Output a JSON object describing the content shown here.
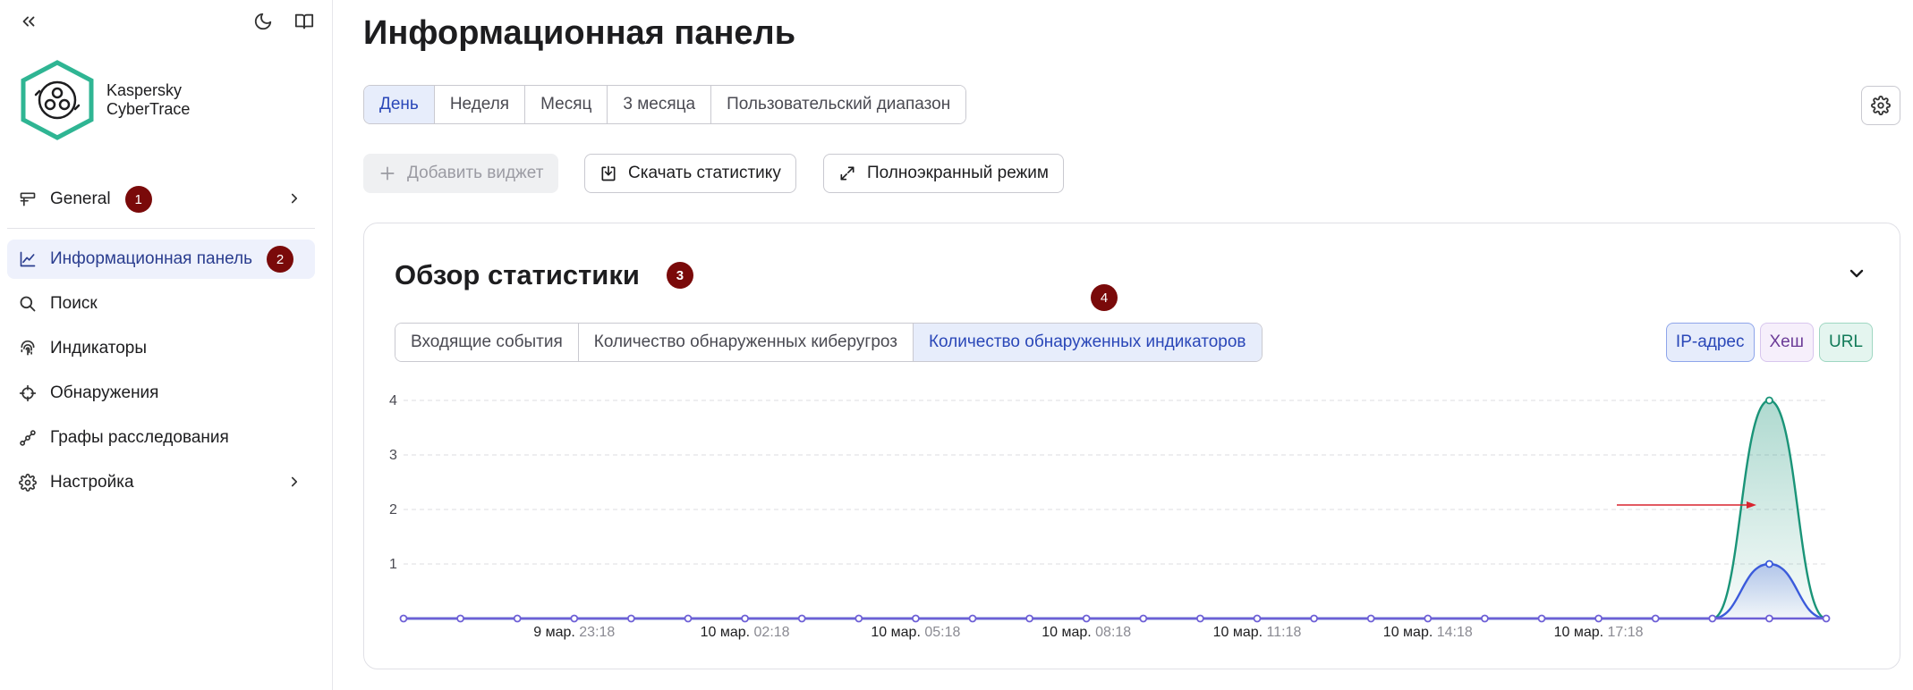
{
  "sidebar": {
    "brand_line1": "Kaspersky",
    "brand_line2": "CyberTrace",
    "icons": {
      "collapse": "double-chevron-left-icon",
      "theme": "moon-icon",
      "docs": "book-icon"
    },
    "items": [
      {
        "label": "General",
        "icon": "layout-icon",
        "badge": "1",
        "has_submenu": true
      },
      {
        "label": "Информационная панель",
        "icon": "chart-line-icon",
        "badge": "2",
        "active": true
      },
      {
        "label": "Поиск",
        "icon": "search-icon"
      },
      {
        "label": "Индикаторы",
        "icon": "fingerprint-icon"
      },
      {
        "label": "Обнаружения",
        "icon": "crosshair-icon"
      },
      {
        "label": "Графы расследования",
        "icon": "graph-icon"
      },
      {
        "label": "Настройка",
        "icon": "gear-icon",
        "has_submenu": true
      }
    ]
  },
  "main": {
    "title": "Информационная панель",
    "periods": [
      "День",
      "Неделя",
      "Месяц",
      "3 месяца",
      "Пользовательский диапазон"
    ],
    "active_period": "День",
    "toolbar": {
      "add_widget": "Добавить виджет",
      "download_stats": "Скачать статистику",
      "fullscreen": "Полноэкранный режим"
    }
  },
  "card": {
    "title": "Обзор статистики",
    "title_badge": "3",
    "float_badge": "4",
    "metrics": [
      "Входящие события",
      "Количество обнаруженных киберугроз",
      "Количество обнаруженных индикаторов"
    ],
    "active_metric": "Количество обнаруженных индикаторов",
    "legend": [
      "IP-адрес",
      "Хеш",
      "URL"
    ]
  },
  "colors": {
    "accent": "#2a47b8",
    "badge": "#7a0a0a",
    "series_ip": "#3b5bdb",
    "series_hash": "#8e5cc8",
    "series_url": "#1a9478",
    "arrow": "#d9232e"
  },
  "chart_data": {
    "type": "area",
    "y_ticks": [
      "1",
      "2",
      "3",
      "4"
    ],
    "ylim": [
      0,
      4
    ],
    "x_labels": [
      {
        "date": "9 мар.",
        "time": "23:18"
      },
      {
        "date": "10 мар.",
        "time": "02:18"
      },
      {
        "date": "10 мар.",
        "time": "05:18"
      },
      {
        "date": "10 мар.",
        "time": "08:18"
      },
      {
        "date": "10 мар.",
        "time": "11:18"
      },
      {
        "date": "10 мар.",
        "time": "14:18"
      },
      {
        "date": "10 мар.",
        "time": "17:18"
      }
    ],
    "series": [
      {
        "name": "URL",
        "values": [
          0,
          0,
          0,
          0,
          0,
          0,
          0,
          0,
          0,
          0,
          0,
          0,
          0,
          0,
          0,
          0,
          0,
          0,
          0,
          0,
          0,
          0,
          0,
          0,
          4,
          0
        ]
      },
      {
        "name": "IP-адрес",
        "values": [
          0,
          0,
          0,
          0,
          0,
          0,
          0,
          0,
          0,
          0,
          0,
          0,
          0,
          0,
          0,
          0,
          0,
          0,
          0,
          0,
          0,
          0,
          0,
          0,
          1,
          0
        ]
      },
      {
        "name": "Хеш",
        "values": [
          0,
          0,
          0,
          0,
          0,
          0,
          0,
          0,
          0,
          0,
          0,
          0,
          0,
          0,
          0,
          0,
          0,
          0,
          0,
          0,
          0,
          0,
          0,
          0,
          0,
          0
        ]
      }
    ],
    "grid": true
  }
}
